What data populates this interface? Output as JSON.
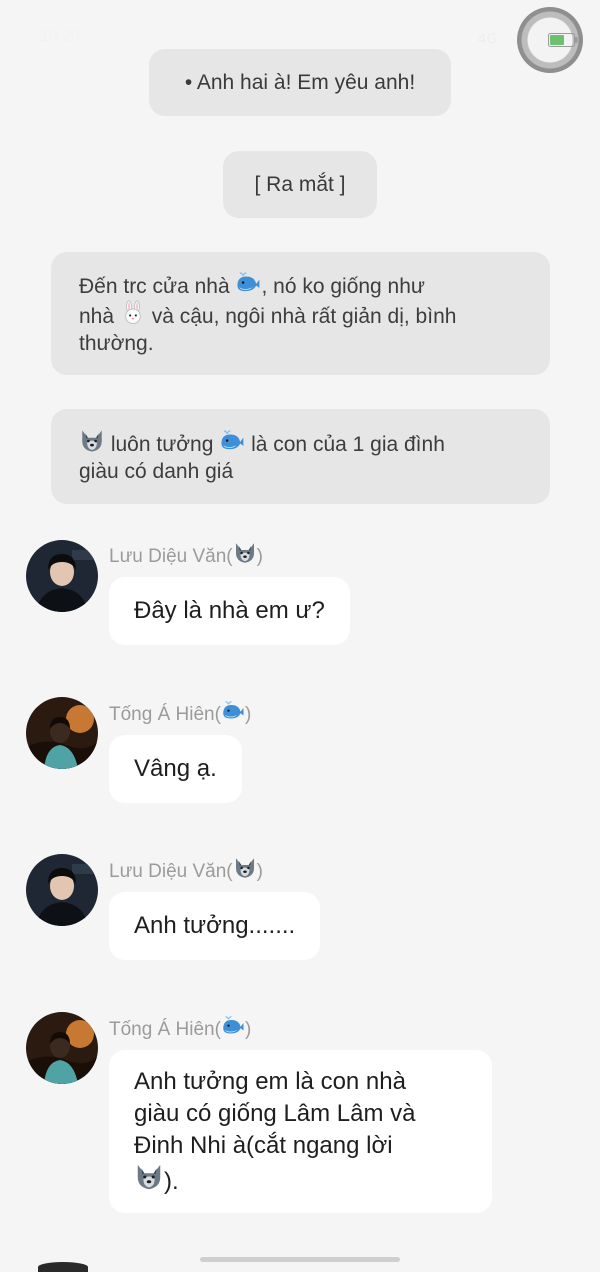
{
  "status_bar": {
    "time": "10:20",
    "signal": "4G"
  },
  "colors": {
    "background": "#f5f5f5",
    "bubble_gray": "#e6e6e6",
    "bubble_white": "#ffffff",
    "sender_name": "#9b9b9b"
  },
  "icons": {
    "wolf": "wolf-emoji-icon",
    "whale": "whale-emoji-icon",
    "rabbit": "rabbit-emoji-icon",
    "battery": "battery-icon"
  },
  "messages": {
    "m1": {
      "text": "• Anh hai à! Em yêu anh!"
    },
    "m2": {
      "text": "[ Ra mắt ]"
    },
    "m3": {
      "p1": "Đến trc cửa nhà ",
      "p2": ", nó ko giống như",
      "p3": "nhà ",
      "p4": " và cậu, ngôi nhà rất giản dị, bình",
      "p5": "thường."
    },
    "m4": {
      "p1": " luôn tưởng ",
      "p2": " là con của 1 gia đình",
      "p3": "giàu có danh giá"
    },
    "m5": {
      "sender": "Lưu Diệu Văn(",
      "sender_close": ")",
      "text": "Đây là nhà em ư?"
    },
    "m6": {
      "sender": "Tống Á Hiên(",
      "sender_close": ")",
      "text": "Vâng ạ."
    },
    "m7": {
      "sender": "Lưu Diệu Văn(",
      "sender_close": ")",
      "text": "Anh tưởng......."
    },
    "m8": {
      "sender": "Tống Á Hiên(",
      "sender_close": ")",
      "l1": "Anh tưởng em là con nhà",
      "l2": "giàu có giống Lâm Lâm và",
      "l3": "Đinh Nhi à(cắt ngang lời",
      "l4": ")."
    }
  }
}
